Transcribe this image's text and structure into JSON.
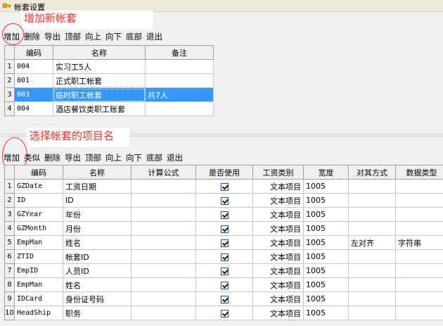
{
  "window": {
    "title": "帐套设置",
    "icon": "key-icon"
  },
  "callouts": {
    "add_new": "增加新帐套",
    "select_items": "选择帐套的项目名"
  },
  "top_toolbar": [
    "增加",
    "删除",
    "导出",
    "顶部",
    "向上",
    "向下",
    "底部",
    "退出"
  ],
  "top_table": {
    "headers": [
      "编码",
      "名称",
      "备注"
    ],
    "rows": [
      {
        "num": "1",
        "code": "004",
        "name": "实习工5人",
        "note": ""
      },
      {
        "num": "2",
        "code": "001",
        "name": "正式职工帐套",
        "note": ""
      },
      {
        "num": "3",
        "code": "003",
        "name": "临时职工帐套",
        "note": "共7人",
        "selected": true
      },
      {
        "num": "4",
        "code": "004",
        "name": "酒店餐饮类职工账套",
        "note": ""
      }
    ]
  },
  "bottom_toolbar": [
    "增加",
    "类似",
    "删除",
    "导出",
    "顶部",
    "向上",
    "向下",
    "底部",
    "退出"
  ],
  "bottom_table": {
    "headers": [
      "编码",
      "名称",
      "计算公式",
      "是否使用",
      "工资类别",
      "宽度",
      "对其方式",
      "数据类型"
    ],
    "rows": [
      {
        "num": "1",
        "code": "GZDate",
        "name": "工资日期",
        "formula": "",
        "used": true,
        "category": "文本项目",
        "width": "1005",
        "align": "",
        "dtype": ""
      },
      {
        "num": "2",
        "code": "ID",
        "name": "ID",
        "formula": "",
        "used": true,
        "category": "文本项目",
        "width": "1005",
        "align": "",
        "dtype": ""
      },
      {
        "num": "3",
        "code": "GZYear",
        "name": "年份",
        "formula": "",
        "used": true,
        "category": "文本项目",
        "width": "1005",
        "align": "",
        "dtype": ""
      },
      {
        "num": "4",
        "code": "GZMonth",
        "name": "月份",
        "formula": "",
        "used": true,
        "category": "文本项目",
        "width": "1005",
        "align": "",
        "dtype": ""
      },
      {
        "num": "5",
        "code": "EmpMan",
        "name": "姓名",
        "formula": "",
        "used": true,
        "category": "文本项目",
        "width": "1005",
        "align": "左对齐",
        "dtype": "字符串"
      },
      {
        "num": "6",
        "code": "ZTID",
        "name": "帐套ID",
        "formula": "",
        "used": true,
        "category": "文本项目",
        "width": "1005",
        "align": "",
        "dtype": ""
      },
      {
        "num": "7",
        "code": "EmpID",
        "name": "人员ID",
        "formula": "",
        "used": true,
        "category": "文本项目",
        "width": "1005",
        "align": "",
        "dtype": ""
      },
      {
        "num": "8",
        "code": "EmpMan",
        "name": "姓名",
        "formula": "",
        "used": true,
        "category": "文本项目",
        "width": "1005",
        "align": "",
        "dtype": ""
      },
      {
        "num": "9",
        "code": "IDCard",
        "name": "身份证号码",
        "formula": "",
        "used": true,
        "category": "文本项目",
        "width": "1005",
        "align": "",
        "dtype": ""
      },
      {
        "num": "10",
        "code": "HeadShip",
        "name": "职务",
        "formula": "",
        "used": true,
        "category": "文本项目",
        "width": "1005",
        "align": "",
        "dtype": ""
      }
    ]
  },
  "colors": {
    "accent_red": "#e8302a",
    "selection": "#3399ff"
  }
}
